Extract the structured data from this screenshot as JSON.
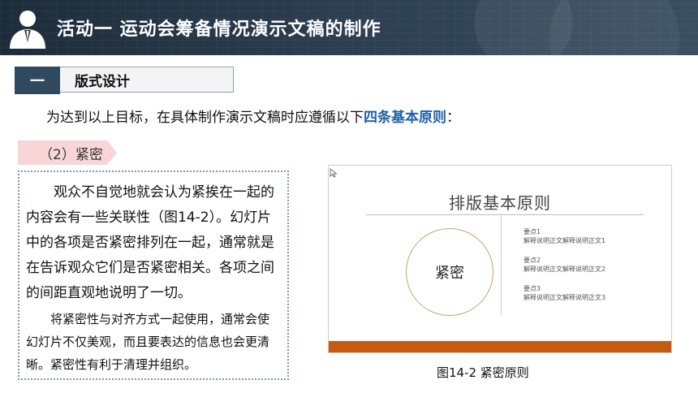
{
  "header": {
    "title": "活动一  运动会筹备情况演示文稿的制作",
    "icon": "user-avatar-icon"
  },
  "section": {
    "number": "一",
    "title": "版式设计"
  },
  "intro": {
    "prefix": "为达到以上目标，在具体制作演示文稿时应遵循以下",
    "highlight": "四条基本原则",
    "suffix": "："
  },
  "tag": "（2）紧密",
  "body": {
    "paragraph1": "观众不自觉地就会认为紧挨在一起的内容会有一些关联性（图14-2）。幻灯片中的各项是否紧密排列在一起，通常就是在告诉观众它们是否紧密相关。各项之间的间距直观地说明了一切。",
    "paragraph2": "将紧密性与对齐方式一起使用，通常会使幻灯片不仅美观，而且要表达的信息也会更清晰。紧密性有利于清理并组织。"
  },
  "figure": {
    "slide_title": "排版基本原则",
    "circle_label": "紧密",
    "points": [
      {
        "title": "要点1",
        "desc": "解释说明正文解释说明正文1"
      },
      {
        "title": "要点2",
        "desc": "解释说明正文解释说明正文2"
      },
      {
        "title": "要点3",
        "desc": "解释说明正文解释说明正文3"
      }
    ],
    "caption": "图14-2  紧密原则"
  },
  "colors": {
    "header_bg": "#2b3d4e",
    "accent_blue": "#1f5fa8",
    "tag_pink": "#f8d6d8",
    "slide_bar": "#c55a11",
    "circle_gold": "#c9a46c"
  }
}
